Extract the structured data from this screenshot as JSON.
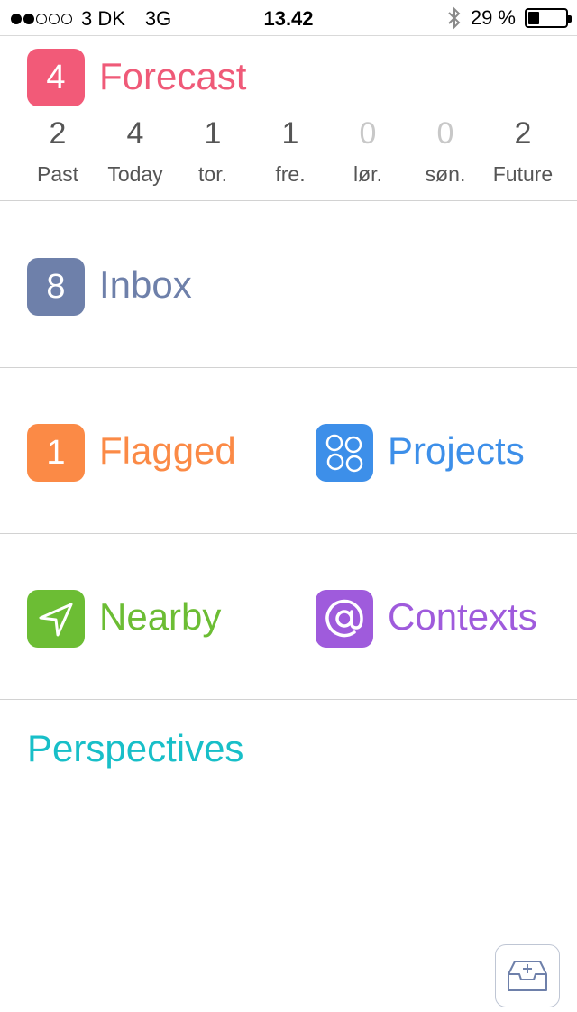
{
  "status_bar": {
    "signal_dots_filled": 2,
    "signal_dots_total": 5,
    "carrier": "3 DK",
    "network": "3G",
    "time": "13.42",
    "bluetooth_icon": "bluetooth-icon",
    "battery_percent": "29 %",
    "battery_level": 0.29
  },
  "forecast": {
    "badge": "4",
    "title": "Forecast",
    "color": "#ef5a78",
    "days": [
      {
        "count": "2",
        "label": "Past"
      },
      {
        "count": "4",
        "label": "Today"
      },
      {
        "count": "1",
        "label": "tor."
      },
      {
        "count": "1",
        "label": "fre."
      },
      {
        "count": "0",
        "label": "lør."
      },
      {
        "count": "0",
        "label": "søn."
      },
      {
        "count": "2",
        "label": "Future"
      }
    ]
  },
  "inbox": {
    "badge": "8",
    "title": "Inbox",
    "color": "#6e80aa"
  },
  "flagged": {
    "badge": "1",
    "title": "Flagged",
    "color": "#fb8a46"
  },
  "projects": {
    "icon": "projects-circles-icon",
    "title": "Projects",
    "color": "#3d8fe9"
  },
  "nearby": {
    "icon": "location-arrow-icon",
    "title": "Nearby",
    "color": "#6cbd34"
  },
  "contexts": {
    "icon": "at-sign-icon",
    "title": "Contexts",
    "color": "#9f5bdc"
  },
  "perspectives": {
    "title": "Perspectives",
    "color": "#18bfc8"
  },
  "quick_entry": {
    "icon": "inbox-add-icon"
  }
}
